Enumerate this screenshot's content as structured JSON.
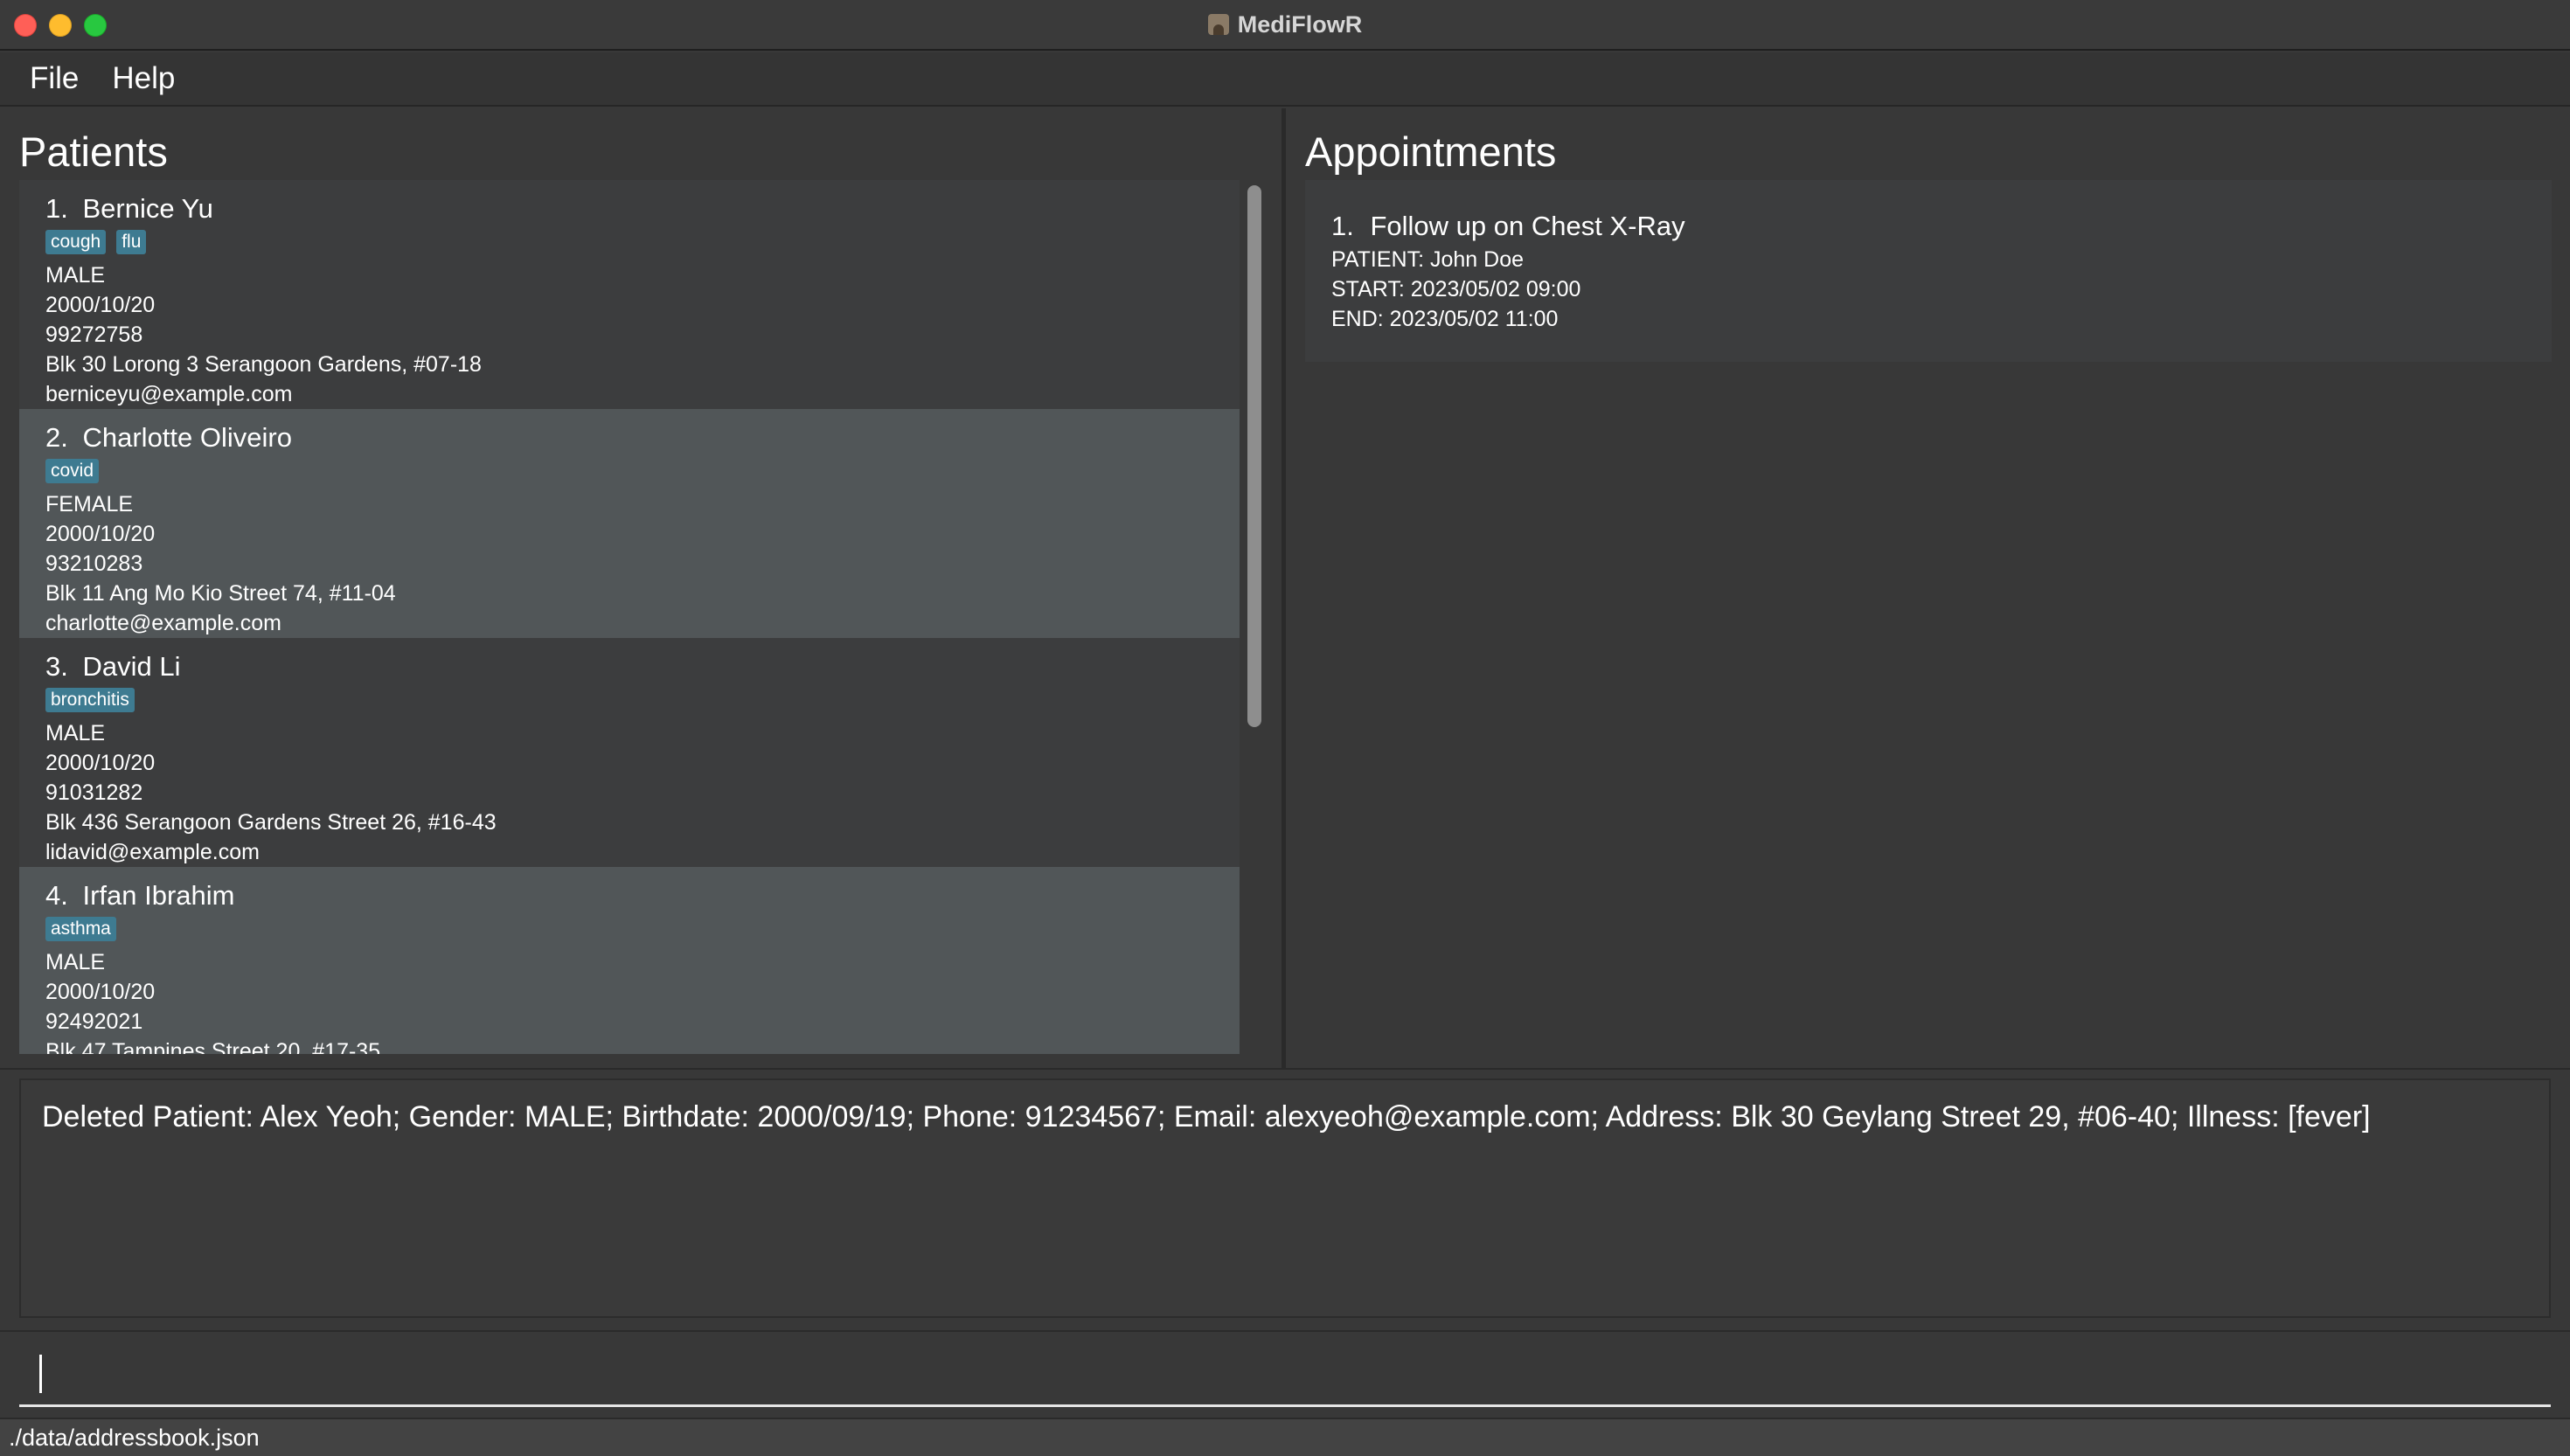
{
  "window": {
    "title": "MediFlowR"
  },
  "menu": {
    "file": "File",
    "help": "Help"
  },
  "patients": {
    "title": "Patients",
    "items": [
      {
        "index": "1.",
        "name": "Bernice Yu",
        "tags": [
          "cough",
          "flu"
        ],
        "gender": "MALE",
        "birthdate": "2000/10/20",
        "phone": "99272758",
        "address": "Blk 30 Lorong 3 Serangoon Gardens, #07-18",
        "email": "berniceyu@example.com"
      },
      {
        "index": "2.",
        "name": "Charlotte Oliveiro",
        "tags": [
          "covid"
        ],
        "gender": "FEMALE",
        "birthdate": "2000/10/20",
        "phone": "93210283",
        "address": "Blk 11 Ang Mo Kio Street 74, #11-04",
        "email": "charlotte@example.com"
      },
      {
        "index": "3.",
        "name": "David Li",
        "tags": [
          "bronchitis"
        ],
        "gender": "MALE",
        "birthdate": "2000/10/20",
        "phone": "91031282",
        "address": "Blk 436 Serangoon Gardens Street 26, #16-43",
        "email": "lidavid@example.com"
      },
      {
        "index": "4.",
        "name": "Irfan Ibrahim",
        "tags": [
          "asthma"
        ],
        "gender": "MALE",
        "birthdate": "2000/10/20",
        "phone": "92492021",
        "address": "Blk 47 Tampines Street 20, #17-35",
        "email": ""
      }
    ]
  },
  "appointments": {
    "title": "Appointments",
    "items": [
      {
        "index": "1.",
        "title": "Follow up on Chest X-Ray",
        "patient": "PATIENT: John Doe",
        "start": "START: 2023/05/02 09:00",
        "end": "END: 2023/05/02 11:00"
      }
    ]
  },
  "result": {
    "text": "Deleted Patient: Alex Yeoh; Gender: MALE; Birthdate: 2000/09/19; Phone: 91234567; Email: alexyeoh@example.com; Address: Blk 30 Geylang Street 29, #06-40; Illness: [fever]"
  },
  "command": {
    "value": "",
    "placeholder": ""
  },
  "status": {
    "path": "./data/addressbook.json"
  },
  "colors": {
    "background": "#383838",
    "card_odd": "#3c3d3e",
    "card_even": "#515658",
    "tag": "#3e7b91"
  }
}
